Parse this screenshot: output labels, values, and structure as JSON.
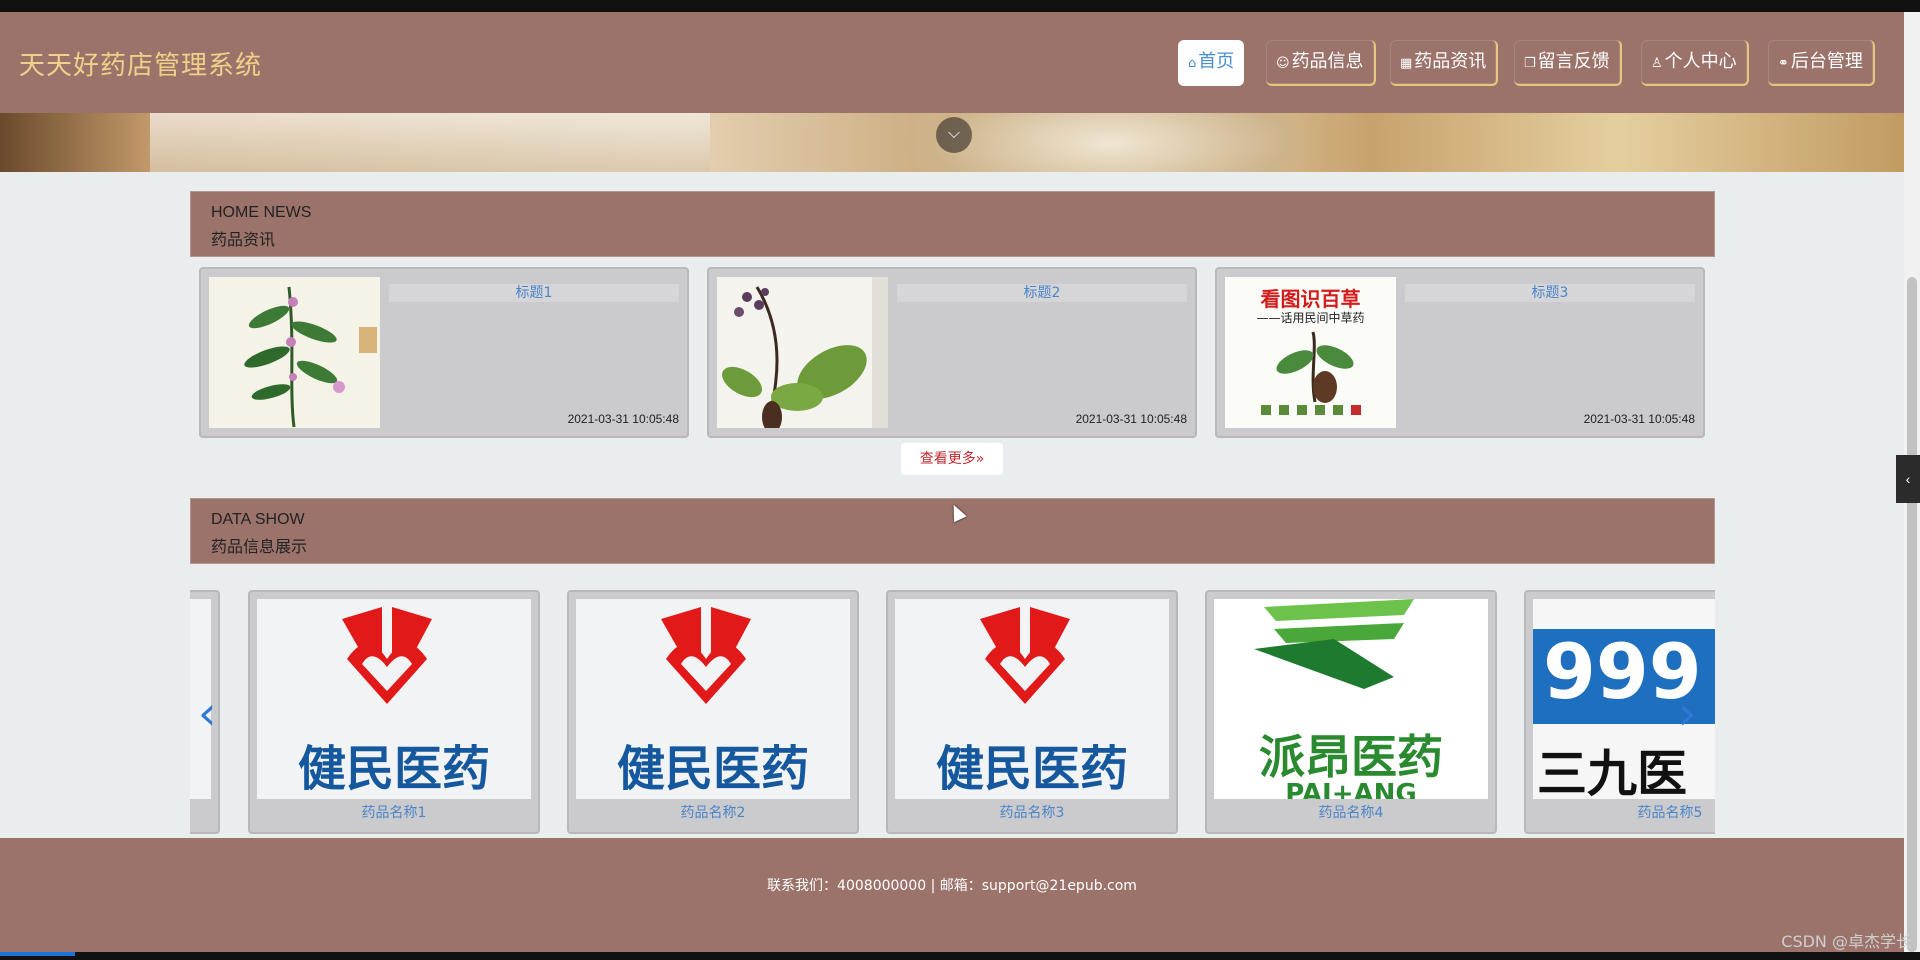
{
  "site": {
    "title": "天天好药店管理系统"
  },
  "nav": [
    {
      "label": "首页",
      "icon": "home-icon",
      "glyph": "⌂",
      "active": true
    },
    {
      "label": "药品信息",
      "icon": "pill-icon",
      "glyph": "☺"
    },
    {
      "label": "药品资讯",
      "icon": "gift-icon",
      "glyph": "▦"
    },
    {
      "label": "留言反馈",
      "icon": "book-icon",
      "glyph": "❐"
    },
    {
      "label": "个人中心",
      "icon": "user-icon",
      "glyph": "♙"
    },
    {
      "label": "后台管理",
      "icon": "link-icon",
      "glyph": "⚭"
    }
  ],
  "news_section": {
    "en": "HOME NEWS",
    "cn": "药品资讯"
  },
  "news": [
    {
      "title": "标题1",
      "time": "2021-03-31 10:05:48"
    },
    {
      "title": "标题2",
      "time": "2021-03-31 10:05:48"
    },
    {
      "title": "标题3",
      "time": "2021-03-31 10:05:48",
      "cover_title": "看图识百草",
      "cover_subtitle": "——话用民间中草药"
    }
  ],
  "more_button": "查看更多",
  "product_section": {
    "en": "DATA SHOW",
    "cn": "药品信息展示"
  },
  "products": [
    {
      "name": "药品名称1",
      "logo": "健民医药"
    },
    {
      "name": "药品名称2",
      "logo": "健民医药"
    },
    {
      "name": "药品名称3",
      "logo": "健民医药"
    },
    {
      "name": "药品名称4",
      "logo": "派昂医药",
      "logo_sub": "PAI+ANG"
    },
    {
      "name": "药品名称5",
      "logo": "三九医",
      "logo_top": "999"
    }
  ],
  "footer": {
    "text": "联系我们：4008000000 | 邮箱：support@21epub.com"
  },
  "watermark": "CSDN @卓杰学长",
  "colors": {
    "header": "#9b736b",
    "title_gold": "#f2d08a",
    "link_blue": "#4a84c9",
    "more_red": "#c0292f",
    "logo_red": "#e11919",
    "logo_blue": "#16589e",
    "logo_green": "#2a8a2f"
  }
}
